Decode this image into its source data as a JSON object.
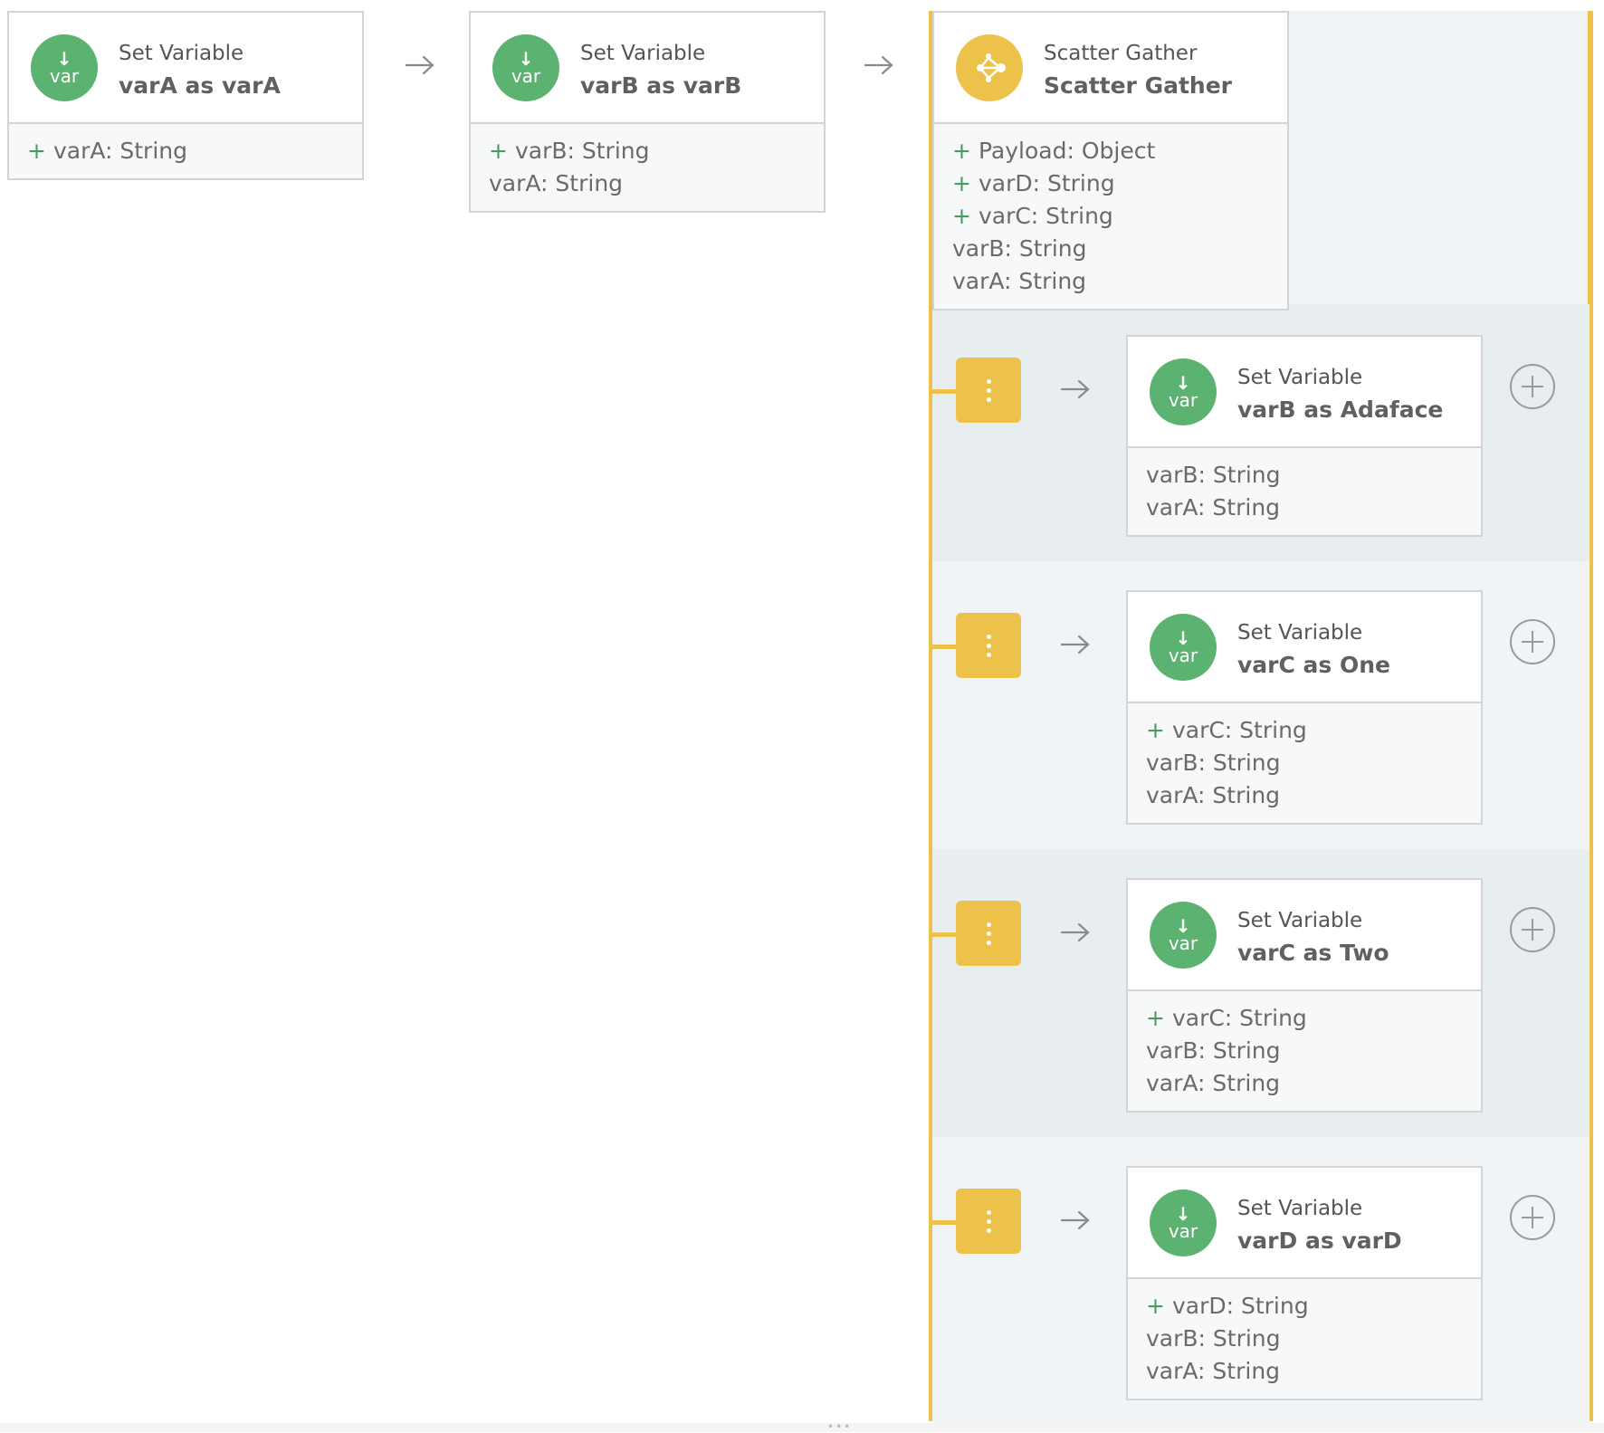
{
  "flow": {
    "steps": [
      {
        "title": "Set Variable",
        "name": "varA as varA",
        "icon": "var-icon",
        "props": [
          {
            "added": true,
            "label": "varA: String"
          }
        ]
      },
      {
        "title": "Set Variable",
        "name": "varB as varB",
        "icon": "var-icon",
        "props": [
          {
            "added": true,
            "label": "varB: String"
          },
          {
            "added": false,
            "label": "varA: String"
          }
        ]
      },
      {
        "title": "Scatter Gather",
        "name": "Scatter Gather",
        "icon": "scatter-gather-icon",
        "props": [
          {
            "added": true,
            "label": "Payload: Object"
          },
          {
            "added": true,
            "label": "varD: String"
          },
          {
            "added": true,
            "label": "varC: String"
          },
          {
            "added": false,
            "label": "varB: String"
          },
          {
            "added": false,
            "label": "varA: String"
          }
        ]
      }
    ],
    "routes": [
      {
        "title": "Set Variable",
        "name": "varB as Adaface",
        "props": [
          {
            "added": false,
            "label": "varB: String"
          },
          {
            "added": false,
            "label": "varA: String"
          }
        ]
      },
      {
        "title": "Set Variable",
        "name": "varC as One",
        "props": [
          {
            "added": true,
            "label": "varC: String"
          },
          {
            "added": false,
            "label": "varB: String"
          },
          {
            "added": false,
            "label": "varA: String"
          }
        ]
      },
      {
        "title": "Set Variable",
        "name": "varC as Two",
        "props": [
          {
            "added": true,
            "label": "varC: String"
          },
          {
            "added": false,
            "label": "varB: String"
          },
          {
            "added": false,
            "label": "varA: String"
          }
        ]
      },
      {
        "title": "Set Variable",
        "name": "varD as varD",
        "props": [
          {
            "added": true,
            "label": "varD: String"
          },
          {
            "added": false,
            "label": "varB: String"
          },
          {
            "added": false,
            "label": "varA: String"
          }
        ]
      }
    ],
    "icon_text": {
      "var": "var",
      "arrow": "↓",
      "plus": "+"
    },
    "colors": {
      "var_green": "#5cb270",
      "scatter_yellow": "#ecc24a",
      "lane_bg_a": "#e8eef0",
      "lane_bg_b": "#f0f4f6"
    }
  }
}
